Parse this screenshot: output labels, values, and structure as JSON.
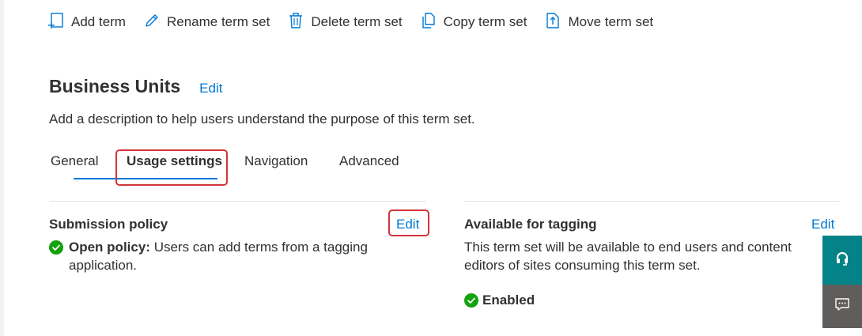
{
  "toolbar": {
    "add_term": "Add term",
    "rename_term_set": "Rename term set",
    "delete_term_set": "Delete term set",
    "copy_term_set": "Copy term set",
    "move_term_set": "Move term set"
  },
  "header": {
    "title": "Business Units",
    "edit_label": "Edit",
    "description": "Add a description to help users understand the purpose of this term set."
  },
  "tabs": [
    {
      "label": "General",
      "selected": false
    },
    {
      "label": "Usage settings",
      "selected": true
    },
    {
      "label": "Navigation",
      "selected": false
    },
    {
      "label": "Advanced",
      "selected": false
    }
  ],
  "submission_policy": {
    "title": "Submission policy",
    "edit_label": "Edit",
    "status_label": "Open policy:",
    "status_text": " Users can add terms from a tagging application."
  },
  "available_for_tagging": {
    "title": "Available for tagging",
    "edit_label": "Edit",
    "description": "This term set will be available to end users and content editors of sites consuming this term set.",
    "status": "Enabled"
  },
  "colors": {
    "accent": "#0078d4",
    "success": "#13a10e",
    "highlight": "#d13438",
    "help_button": "#038387",
    "feedback_button": "#605e5c"
  },
  "icons": {
    "add_term": "add-term-icon",
    "rename": "pencil-icon",
    "delete": "trash-icon",
    "copy": "copy-icon",
    "move": "move-icon",
    "check": "checkmark-circle-icon",
    "help": "headset-icon",
    "feedback": "feedback-icon"
  }
}
